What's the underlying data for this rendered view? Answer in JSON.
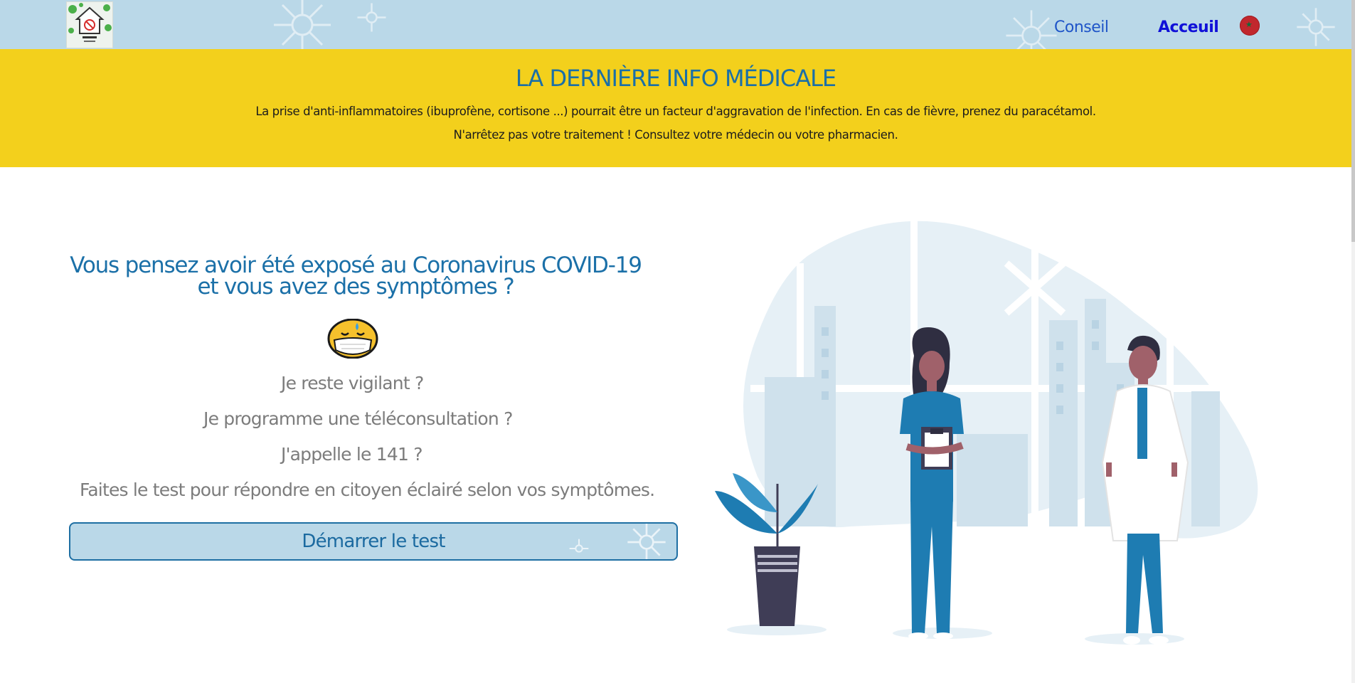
{
  "nav": {
    "links": [
      {
        "label": "Conseil"
      },
      {
        "label": "Acceuil"
      }
    ],
    "flag_icon": "morocco-flag-icon"
  },
  "banner": {
    "title": "LA DERNIÈRE INFO MÉDICALE",
    "line1": "La prise d'anti-inflammatoires (ibuprofène, cortisone ...) pourrait être un facteur d'aggravation de l'infection. En cas de fièvre, prenez du paracétamol.",
    "line2": "N'arrêtez pas votre traitement ! Consultez votre médecin ou votre pharmacien."
  },
  "main": {
    "headline": "Vous pensez avoir été exposé au Coronavirus COVID-19 et vous avez des symptômes ?",
    "emoji_icon": "masked-sweating-face-icon",
    "questions": [
      "Je reste vigilant ?",
      "Je programme une téléconsultation ?",
      "J'appelle le 141 ?",
      "Faites le test pour répondre en citoyen éclairé selon vos symptômes."
    ],
    "start_button": "Démarrer le test"
  },
  "colors": {
    "nav_bg": "#bad8e8",
    "banner_bg": "#f3d01c",
    "accent_blue": "#1b70a8",
    "question_gray": "#7c7c7c"
  }
}
